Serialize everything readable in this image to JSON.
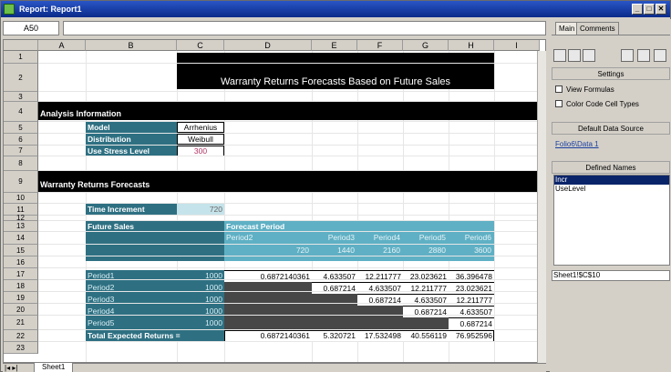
{
  "window": {
    "title": "Report: Report1",
    "controls": [
      "_",
      "□",
      "✕"
    ]
  },
  "formula_bar": {
    "cell_ref": "A50",
    "formula": ""
  },
  "columns": [
    "A",
    "B",
    "C",
    "D",
    "E",
    "F",
    "G",
    "H",
    "I"
  ],
  "rows": [
    "1",
    "2",
    "3",
    "4",
    "5",
    "6",
    "7",
    "8",
    "9",
    "10",
    "11",
    "12",
    "13",
    "14",
    "15",
    "16",
    "17",
    "18",
    "19",
    "20",
    "21",
    "22",
    "23"
  ],
  "report": {
    "title": "Warranty Returns Forecasts Based on Future Sales",
    "analysis_header": "Analysis Information",
    "model_label": "Model",
    "model_value": "Arrhenius",
    "distribution_label": "Distribution",
    "distribution_value": "Weibull",
    "stress_label": "Use Stress Level",
    "stress_value": "300",
    "forecast_header": "Warranty Returns Forecasts",
    "time_increment_label": "Time Increment",
    "time_increment_value": "720",
    "future_sales_label": "Future Sales",
    "forecast_period_label": "Forecast Period",
    "period_headers": [
      "Period2",
      "Period3",
      "Period4",
      "Period5",
      "Period6"
    ],
    "period_times": [
      "720",
      "1440",
      "2160",
      "2880",
      "3600"
    ],
    "sales_rows": [
      {
        "label": "Period1",
        "sales": "1000",
        "values": [
          "0.6872140361",
          "4.633507",
          "12.211777",
          "23.023621",
          "36.396478"
        ]
      },
      {
        "label": "Period2",
        "sales": "1000",
        "values": [
          "",
          "0.687214",
          "4.633507",
          "12.211777",
          "23.023621"
        ]
      },
      {
        "label": "Period3",
        "sales": "1000",
        "values": [
          "",
          "",
          "0.687214",
          "4.633507",
          "12.211777"
        ]
      },
      {
        "label": "Period4",
        "sales": "1000",
        "values": [
          "",
          "",
          "",
          "0.687214",
          "4.633507"
        ]
      },
      {
        "label": "Period5",
        "sales": "1000",
        "values": [
          "",
          "",
          "",
          "",
          "0.687214"
        ]
      }
    ],
    "total_label": "Total Expected Returns =",
    "total_values": [
      "0.6872140361",
      "5.320721",
      "17.532498",
      "40.556119",
      "76.952596"
    ]
  },
  "sheet_tab": "Sheet1",
  "panel": {
    "tabs": [
      "Main",
      "Comments"
    ],
    "settings_header": "Settings",
    "view_formulas": "View Formulas",
    "color_code": "Color Code Cell Types",
    "default_source_header": "Default Data Source",
    "default_source_link": "Folio6\\Data 1",
    "defined_names_header": "Defined Names",
    "defined_names": [
      "Incr",
      "UseLevel"
    ],
    "selected_ref": "Sheet1!$C$10"
  }
}
